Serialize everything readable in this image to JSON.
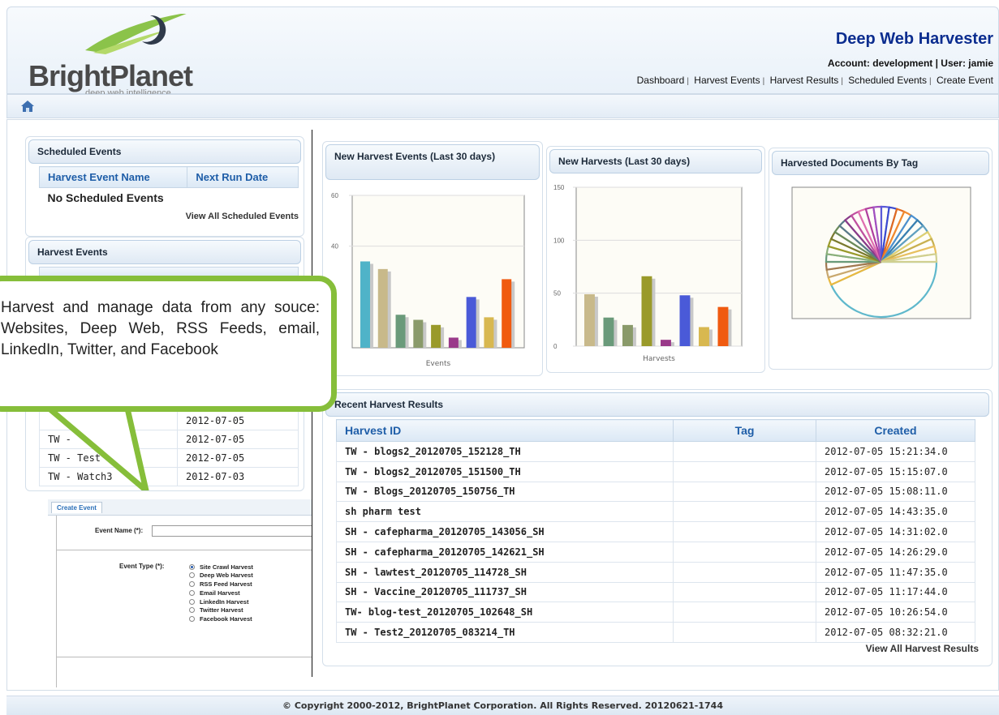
{
  "brand": {
    "logo_text": "BrightPlanet",
    "logo_sub": "deep web intelligence"
  },
  "header": {
    "title": "Deep Web Harvester",
    "account": "Account: development | User: jamie",
    "nav": [
      "Dashboard",
      "Harvest Events",
      "Harvest Results",
      "Scheduled Events",
      "Create Event"
    ]
  },
  "scheduled": {
    "title": "Scheduled Events",
    "col1": "Harvest Event Name",
    "col2": "Next Run Date",
    "empty": "No Scheduled Events",
    "view_all": "View All Scheduled Events"
  },
  "harvest_events": {
    "title": "Harvest Events",
    "rows": [
      {
        "name": "",
        "date": "2012-07-05"
      },
      {
        "name": "TW - ",
        "date": "2012-07-05"
      },
      {
        "name": "TW - Test",
        "date": "2012-07-05"
      },
      {
        "name": "TW - Watch3",
        "date": "2012-07-03"
      }
    ]
  },
  "callout": {
    "text": "Harvest and manage data from any souce: Websites, Deep Web, RSS Feeds, email, LinkedIn, Twitter, and Facebook"
  },
  "create_event": {
    "tab": "Create Event",
    "name_label": "Event Name (*):",
    "type_label": "Event Type (*):",
    "options": [
      "Site Crawl Harvest",
      "Deep Web Harvest",
      "RSS Feed Harvest",
      "Email Harvest",
      "LinkedIn Harvest",
      "Twitter Harvest",
      "Facebook Harvest"
    ],
    "selected": "Site Crawl Harvest"
  },
  "chart_data": [
    {
      "type": "bar",
      "title": "New Harvest Events (Last 30 days)",
      "xlabel": "Events",
      "ylim": [
        0,
        60
      ],
      "yticks": [
        60,
        40
      ],
      "values": [
        34,
        31,
        13,
        11,
        9,
        4,
        20,
        12,
        27
      ],
      "colors": [
        "#4fb3c8",
        "#c8b98a",
        "#6a9a7a",
        "#8a9a6a",
        "#9a9a2a",
        "#9a3a8a",
        "#4a5ad8",
        "#d8b850",
        "#f05a10"
      ]
    },
    {
      "type": "bar",
      "title": "New Harvests (Last 30 days)",
      "xlabel": "Harvests",
      "ylim": [
        0,
        150
      ],
      "yticks": [
        150,
        100,
        50,
        0
      ],
      "values": [
        49,
        27,
        20,
        66,
        6,
        48,
        18,
        37
      ],
      "colors": [
        "#c8b98a",
        "#6a9a7a",
        "#8a9a6a",
        "#9a9a2a",
        "#9a3a8a",
        "#4a5ad8",
        "#d8b850",
        "#f05a10"
      ]
    },
    {
      "type": "pie",
      "title": "Harvested Documents By Tag",
      "values": [
        38,
        2,
        2,
        2,
        2,
        2,
        2,
        2,
        2,
        2,
        2,
        2,
        2,
        2,
        2,
        2,
        2,
        2,
        2,
        2,
        2,
        2,
        2,
        2,
        2,
        2
      ],
      "colors": [
        "#5fb8cc",
        "#e8b840",
        "#c8a870",
        "#a07850",
        "#6a9a7a",
        "#8ab07a",
        "#9a9a2a",
        "#7a7a30",
        "#6a8a5a",
        "#5a7a8a",
        "#8a3a8a",
        "#c050a0",
        "#e070b0",
        "#b040a0",
        "#a050c0",
        "#5a5ad8",
        "#3a4ad0",
        "#e06a20",
        "#f08a30",
        "#4a90d0",
        "#3a80b0",
        "#60a0c0",
        "#e0d070",
        "#c8b050",
        "#e8c060",
        "#d0d090"
      ]
    }
  ],
  "recent": {
    "title": "Recent Harvest Results",
    "cols": [
      "Harvest ID",
      "Tag",
      "Created"
    ],
    "rows": [
      [
        "TW - blogs2_20120705_152128_TH",
        "",
        "2012-07-05 15:21:34.0"
      ],
      [
        "TW - blogs2_20120705_151500_TH",
        "",
        "2012-07-05 15:15:07.0"
      ],
      [
        "TW - Blogs_20120705_150756_TH",
        "",
        "2012-07-05 15:08:11.0"
      ],
      [
        "sh pharm test",
        "",
        "2012-07-05 14:43:35.0"
      ],
      [
        "SH - cafepharma_20120705_143056_SH",
        "",
        "2012-07-05 14:31:02.0"
      ],
      [
        "SH - cafepharma_20120705_142621_SH",
        "",
        "2012-07-05 14:26:29.0"
      ],
      [
        "SH - lawtest_20120705_114728_SH",
        "",
        "2012-07-05 11:47:35.0"
      ],
      [
        "SH - Vaccine_20120705_111737_SH",
        "",
        "2012-07-05 11:17:44.0"
      ],
      [
        "TW- blog-test_20120705_102648_SH",
        "",
        "2012-07-05 10:26:54.0"
      ],
      [
        "TW - Test2_20120705_083214_TH",
        "",
        "2012-07-05 08:32:21.0"
      ]
    ],
    "view_all": "View All Harvest Results"
  },
  "footer": {
    "text": "© Copyright 2000-2012, BrightPlanet Corporation. All Rights Reserved. 20120621-1744"
  }
}
